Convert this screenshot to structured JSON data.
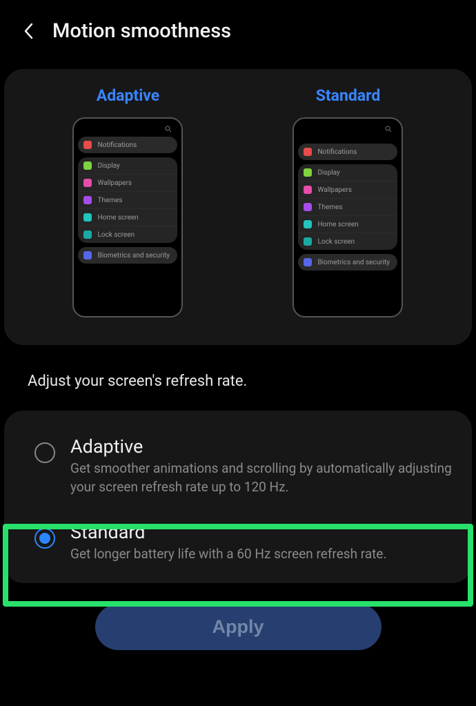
{
  "header": {
    "title": "Motion smoothness"
  },
  "preview": {
    "adaptive_label": "Adaptive",
    "standard_label": "Standard",
    "mock_items": {
      "notifications": "Notifications",
      "display": "Display",
      "wallpapers": "Wallpapers",
      "themes": "Themes",
      "home_screen": "Home screen",
      "lock_screen": "Lock screen",
      "biometrics": "Biometrics and security"
    }
  },
  "section_text": "Adjust your screen's refresh rate.",
  "options": {
    "adaptive": {
      "title": "Adaptive",
      "desc": "Get smoother animations and scrolling by automatically adjusting your screen refresh rate up to 120 Hz.",
      "selected": false
    },
    "standard": {
      "title": "Standard",
      "desc": "Get longer battery life with a 60 Hz screen refresh rate.",
      "selected": true
    }
  },
  "apply_label": "Apply"
}
